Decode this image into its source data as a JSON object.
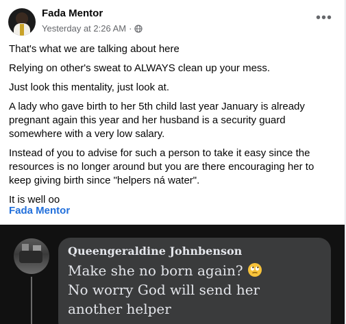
{
  "post": {
    "author": "Fada Mentor",
    "timestamp": "Yesterday at 2:26 AM",
    "separator": "·",
    "privacy_icon": "globe-icon",
    "more_label": "•••",
    "paragraphs": [
      "That's what we are talking about here",
      "Relying on other's sweat to ALWAYS clean up your mess.",
      "Just look this mentality, just look at.",
      "A lady who gave birth to her 5th child last year January is already pregnant again this year and her husband is a security guard somewhere with a very low salary.",
      "Instead of you to advise for such a person to take it easy since the resources is no longer around but you are there encouraging her to keep giving birth since \"helpers ná water\".",
      "It is well oo"
    ],
    "tagged": "Fada Mentor"
  },
  "image": {
    "commenter": "Queengeraldine Johnbenson",
    "lines": [
      "Make she no born again?",
      "No worry God will send her",
      "another helper"
    ],
    "emoji": "rolling-eyes-emoji-icon"
  },
  "colors": {
    "link": "#216fdb",
    "meta": "#65676b",
    "bubble": "#3a3b3c",
    "image_bg": "#111111"
  }
}
